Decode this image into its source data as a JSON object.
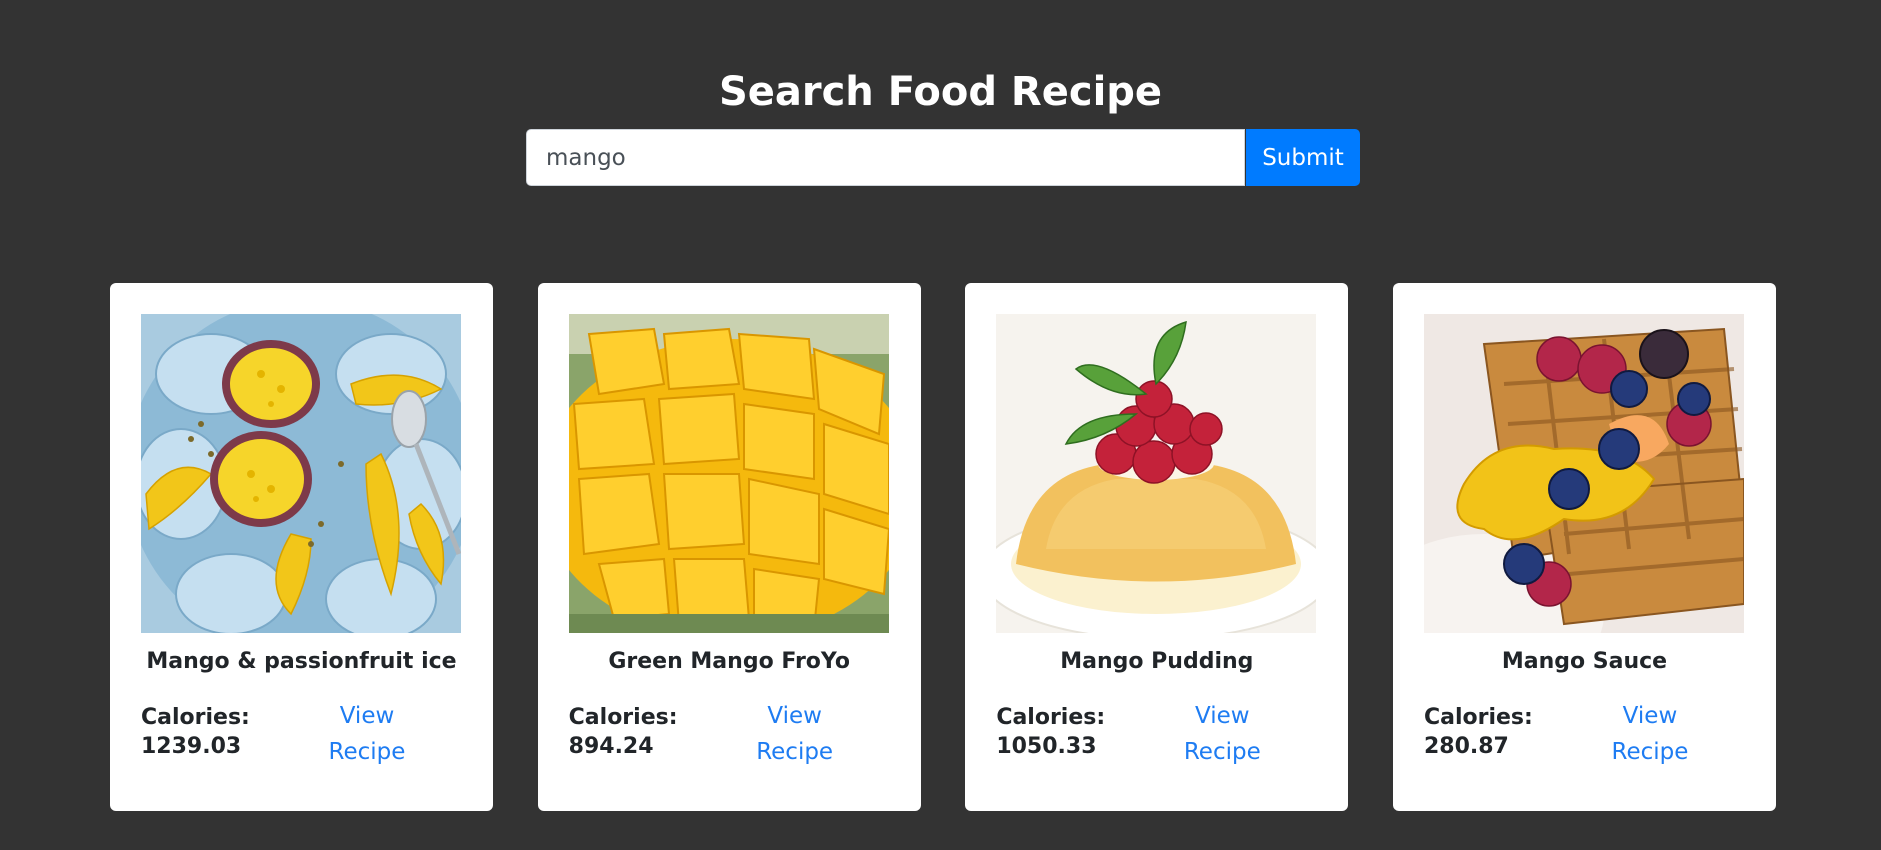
{
  "header": {
    "title": "Search Food Recipe"
  },
  "search": {
    "value": "mango",
    "submit_label": "Submit"
  },
  "cards": [
    {
      "title": "Mango & passionfruit ice",
      "calories_label": "Calories:",
      "calories": "1239.03",
      "link_line1": "View",
      "link_line2": "Recipe"
    },
    {
      "title": "Green Mango FroYo",
      "calories_label": "Calories:",
      "calories": "894.24",
      "link_line1": "View",
      "link_line2": "Recipe"
    },
    {
      "title": "Mango Pudding",
      "calories_label": "Calories:",
      "calories": "1050.33",
      "link_line1": "View",
      "link_line2": "Recipe"
    },
    {
      "title": "Mango Sauce",
      "calories_label": "Calories:",
      "calories": "280.87",
      "link_line1": "View",
      "link_line2": "Recipe"
    }
  ],
  "colors": {
    "background": "#333333",
    "accent": "#007bff",
    "link": "#1e7cf2"
  }
}
